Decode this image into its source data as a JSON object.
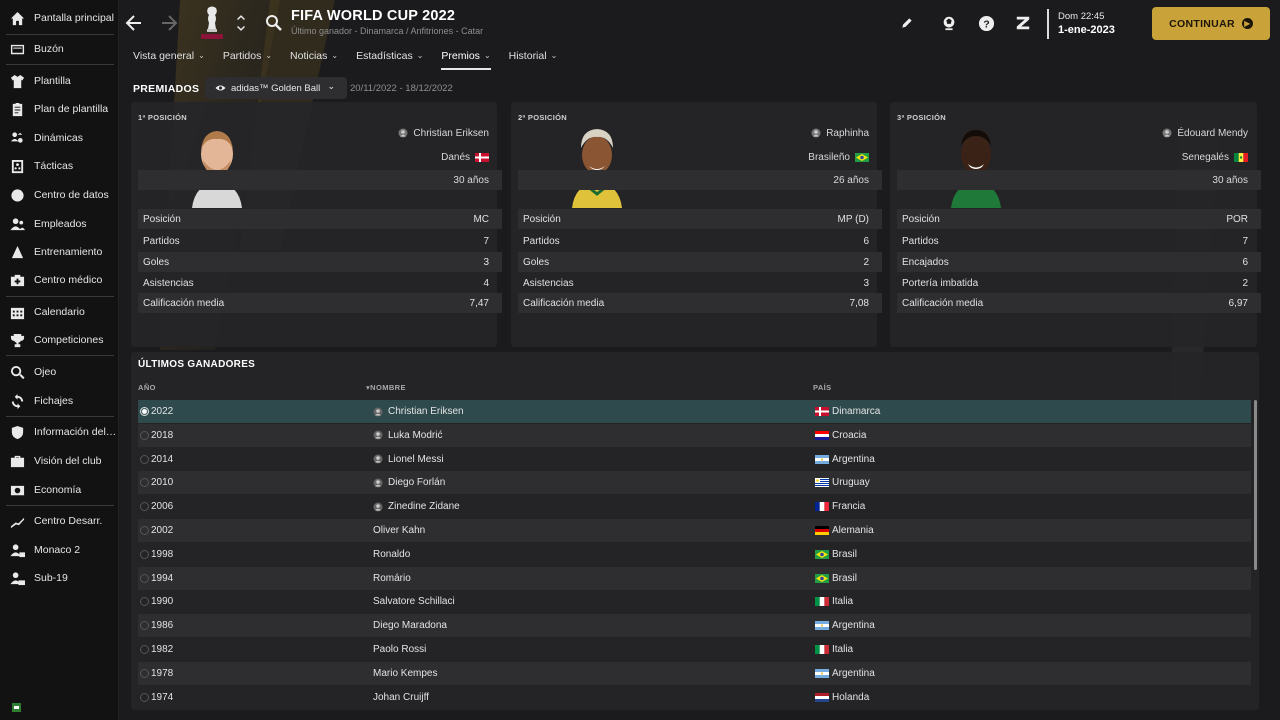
{
  "sidebar": {
    "items": [
      {
        "label": "Pantalla principal",
        "icon": "home-icon"
      },
      {
        "label": "Buzón",
        "icon": "inbox-icon"
      },
      {
        "label": "Plantilla",
        "icon": "shirt-icon"
      },
      {
        "label": "Plan de plantilla",
        "icon": "clipboard-icon"
      },
      {
        "label": "Dinámicas",
        "icon": "dynamics-icon"
      },
      {
        "label": "Tácticas",
        "icon": "tactics-icon"
      },
      {
        "label": "Centro de datos",
        "icon": "data-centre-icon"
      },
      {
        "label": "Empleados",
        "icon": "staff-icon"
      },
      {
        "label": "Entrenamiento",
        "icon": "training-icon"
      },
      {
        "label": "Centro médico",
        "icon": "medical-icon"
      },
      {
        "label": "Calendario",
        "icon": "calendar-icon"
      },
      {
        "label": "Competiciones",
        "icon": "trophy-icon"
      },
      {
        "label": "Ojeo",
        "icon": "scouting-icon"
      },
      {
        "label": "Fichajes",
        "icon": "transfers-icon"
      },
      {
        "label": "Información del…",
        "icon": "shield-icon"
      },
      {
        "label": "Visión del club",
        "icon": "club-vision-icon"
      },
      {
        "label": "Economía",
        "icon": "finances-icon"
      },
      {
        "label": "Centro Desarr.",
        "icon": "development-icon"
      },
      {
        "label": "Monaco 2",
        "icon": "reserve-team-icon"
      },
      {
        "label": "Sub-19",
        "icon": "youth-team-icon"
      }
    ]
  },
  "header": {
    "title": "FIFA WORLD CUP 2022",
    "subtitle": "Último ganador - Dinamarca / Anfitriones - Catar",
    "clock_day": "Dom 22:45",
    "clock_date": "1-ene-2023",
    "continue_label": "CONTINUAR"
  },
  "tabs": [
    {
      "label": "Vista general"
    },
    {
      "label": "Partidos"
    },
    {
      "label": "Noticias"
    },
    {
      "label": "Estadísticas"
    },
    {
      "label": "Premios"
    },
    {
      "label": "Historial"
    }
  ],
  "awards": {
    "section_title": "PREMIADOS",
    "selected_award": "adidas™ Golden Ball",
    "date_range": "20/11/2022 - 18/12/2022"
  },
  "podium": [
    {
      "position_label": "1ª POSICIÓN",
      "name": "Christian Eriksen",
      "nationality": "Danés",
      "age": "30 años",
      "stats": [
        {
          "label": "Posición",
          "value": "MC"
        },
        {
          "label": "Partidos",
          "value": "7"
        },
        {
          "label": "Goles",
          "value": "3"
        },
        {
          "label": "Asistencias",
          "value": "4"
        },
        {
          "label": "Calificación media",
          "value": "7,47"
        }
      ]
    },
    {
      "position_label": "2ª POSICIÓN",
      "name": "Raphinha",
      "nationality": "Brasileño",
      "age": "26 años",
      "stats": [
        {
          "label": "Posición",
          "value": "MP (D)"
        },
        {
          "label": "Partidos",
          "value": "6"
        },
        {
          "label": "Goles",
          "value": "2"
        },
        {
          "label": "Asistencias",
          "value": "3"
        },
        {
          "label": "Calificación media",
          "value": "7,08"
        }
      ]
    },
    {
      "position_label": "3ª POSICIÓN",
      "name": "Édouard Mendy",
      "nationality": "Senegalés",
      "age": "30 años",
      "stats": [
        {
          "label": "Posición",
          "value": "POR"
        },
        {
          "label": "Partidos",
          "value": "7"
        },
        {
          "label": "Encajados",
          "value": "6"
        },
        {
          "label": "Portería imbatida",
          "value": "2"
        },
        {
          "label": "Calificación media",
          "value": "6,97"
        }
      ]
    }
  ],
  "winners": {
    "title": "ÚLTIMOS GANADORES",
    "col_year": "AÑO",
    "col_name": "NOMBRE",
    "col_country": "PAÍS",
    "rows": [
      {
        "year": "2022",
        "name": "Christian Eriksen",
        "country": "Dinamarca"
      },
      {
        "year": "2018",
        "name": "Luka Modrić",
        "country": "Croacia"
      },
      {
        "year": "2014",
        "name": "Lionel Messi",
        "country": "Argentina"
      },
      {
        "year": "2010",
        "name": "Diego Forlán",
        "country": "Uruguay"
      },
      {
        "year": "2006",
        "name": "Zinedine Zidane",
        "country": "Francia"
      },
      {
        "year": "2002",
        "name": "Oliver Kahn",
        "country": "Alemania"
      },
      {
        "year": "1998",
        "name": "Ronaldo",
        "country": "Brasil"
      },
      {
        "year": "1994",
        "name": "Romário",
        "country": "Brasil"
      },
      {
        "year": "1990",
        "name": "Salvatore Schillaci",
        "country": "Italia"
      },
      {
        "year": "1986",
        "name": "Diego Maradona",
        "country": "Argentina"
      },
      {
        "year": "1982",
        "name": "Paolo Rossi",
        "country": "Italia"
      },
      {
        "year": "1978",
        "name": "Mario Kempes",
        "country": "Argentina"
      },
      {
        "year": "1974",
        "name": "Johan Cruijff",
        "country": "Holanda"
      }
    ]
  },
  "colors": {
    "accent_gold": "#c9a33a",
    "selected_row": "#2e4a4d",
    "panel": "#252528"
  }
}
